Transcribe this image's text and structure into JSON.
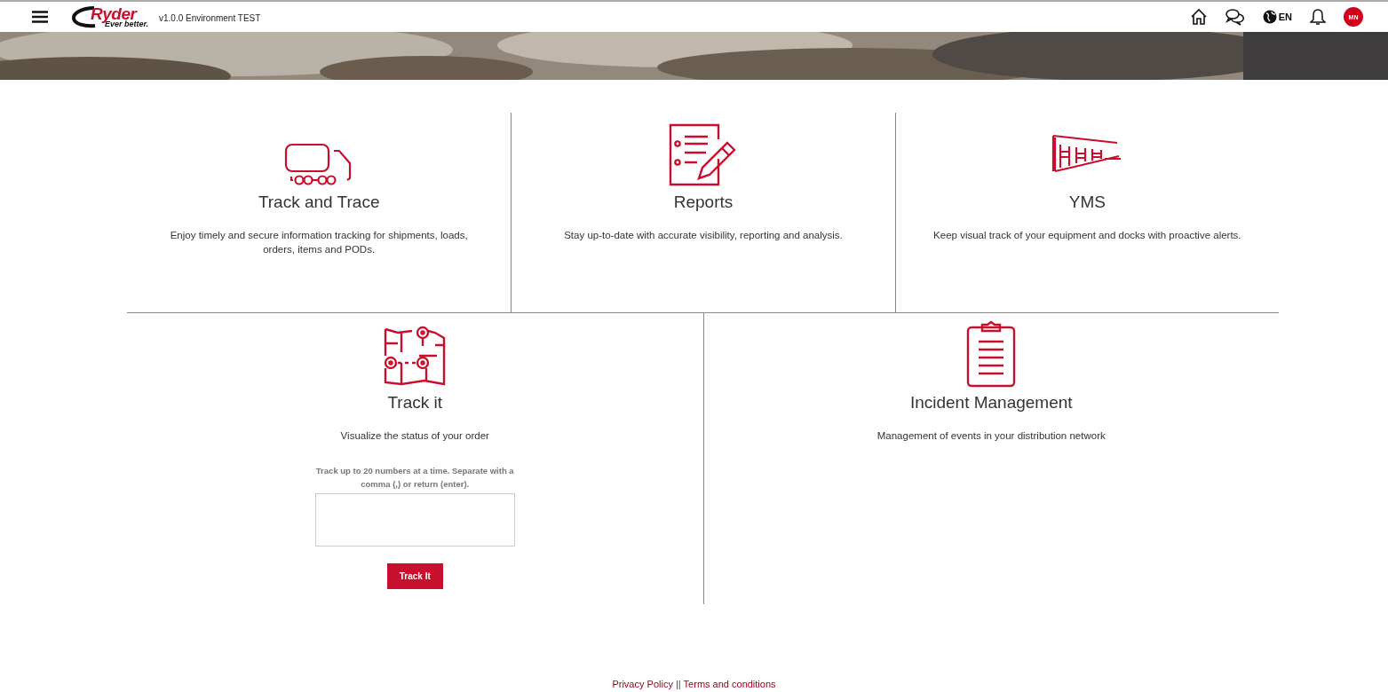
{
  "header": {
    "logo": {
      "name": "Ryder",
      "tagline": "Ever better."
    },
    "version": "v1.0.0 Environment TEST",
    "language": "EN",
    "avatar": "MN"
  },
  "top_cards": [
    {
      "kind": "info",
      "title": "Track and Trace",
      "description": "Enjoy timely and secure information tracking for shipments, loads, orders, items and PODs."
    },
    {
      "kind": "info",
      "title": "Reports",
      "description": "Stay up-to-date with accurate visibility, reporting and analysis."
    },
    {
      "kind": "info",
      "title": "YMS",
      "description": "Keep visual track of your equipment and docks with proactive alerts."
    }
  ],
  "bottom_cards": [
    {
      "kind": "form",
      "title": "Track it",
      "description": "Visualize the status of your order",
      "instructions": "Track up to 20 numbers at a time. Separate with a comma (,) or return (enter).",
      "button": "Track It"
    },
    {
      "kind": "info",
      "title": "Incident Management",
      "description": "Management of events in your distribution network"
    }
  ],
  "footer": {
    "links": [
      "Privacy Policy",
      "Terms and conditions"
    ],
    "separator": "||"
  }
}
